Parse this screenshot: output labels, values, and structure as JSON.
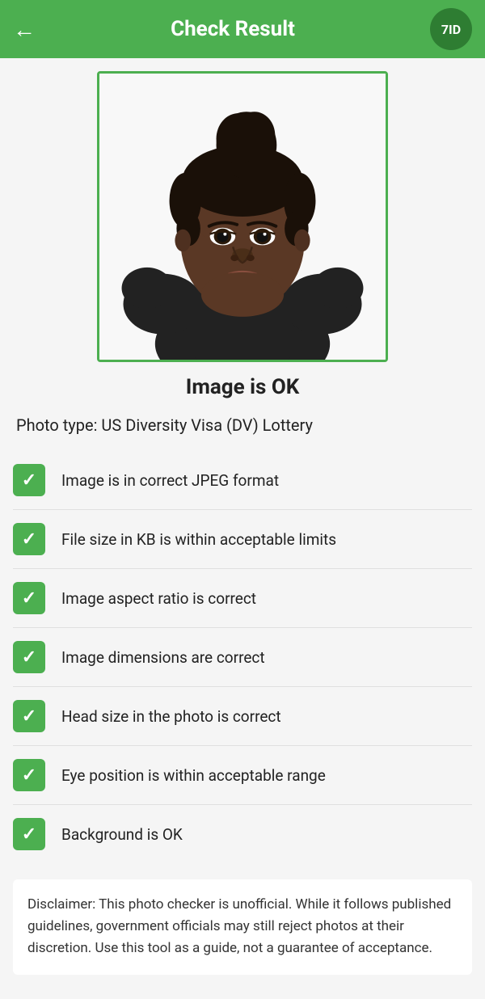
{
  "header": {
    "title": "Check Result",
    "back_label": "←",
    "logo_text": "7ID"
  },
  "result": {
    "status": "Image is OK",
    "photo_type_label": "Photo type: US Diversity Visa (DV) Lottery"
  },
  "checks": [
    {
      "label": "Image is in correct JPEG format",
      "passed": true
    },
    {
      "label": "File size in KB is within acceptable limits",
      "passed": true
    },
    {
      "label": "Image aspect ratio is correct",
      "passed": true
    },
    {
      "label": "Image dimensions are correct",
      "passed": true
    },
    {
      "label": "Head size in the photo is correct",
      "passed": true
    },
    {
      "label": "Eye position is within acceptable range",
      "passed": true
    },
    {
      "label": "Background is OK",
      "passed": true
    }
  ],
  "disclaimer": {
    "text": "Disclaimer: This photo checker is unofficial. While it follows published guidelines, government officials may still reject photos at their discretion. Use this tool as a guide, not a guarantee of acceptance."
  },
  "colors": {
    "green": "#4caf50",
    "dark_green": "#2e7d32"
  }
}
